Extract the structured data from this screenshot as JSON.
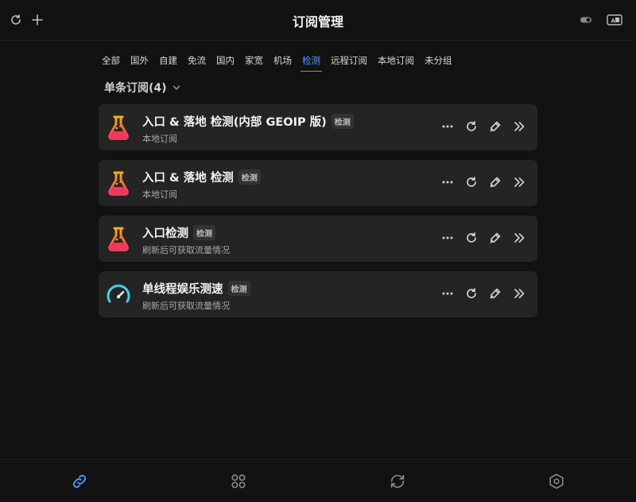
{
  "header": {
    "title": "订阅管理",
    "left_icons": [
      "refresh-icon",
      "plus-icon"
    ],
    "right_icons": [
      "toggle-icon",
      "translate-icon"
    ]
  },
  "tabs": [
    {
      "label": "全部",
      "active": false
    },
    {
      "label": "国外",
      "active": false
    },
    {
      "label": "自建",
      "active": false
    },
    {
      "label": "免流",
      "active": false
    },
    {
      "label": "国内",
      "active": false
    },
    {
      "label": "家宽",
      "active": false
    },
    {
      "label": "机场",
      "active": false
    },
    {
      "label": "检测",
      "active": true
    },
    {
      "label": "远程订阅",
      "active": false
    },
    {
      "label": "本地订阅",
      "active": false
    },
    {
      "label": "未分组",
      "active": false
    }
  ],
  "group": {
    "title": "单条订阅(4)"
  },
  "subscriptions": [
    {
      "title": "入口 & 落地 检测(内部 GEOIP 版)",
      "badge": "检测",
      "subtitle": "本地订阅",
      "icon": "flask-icon"
    },
    {
      "title": "入口 & 落地 检测",
      "badge": "检测",
      "subtitle": "本地订阅",
      "icon": "flask-icon"
    },
    {
      "title": "入口检测",
      "badge": "检测",
      "subtitle": "刷新后可获取流量情况",
      "icon": "flask-icon"
    },
    {
      "title": "单线程娱乐测速",
      "badge": "检测",
      "subtitle": "刷新后可获取流量情况",
      "icon": "speedometer-icon"
    }
  ],
  "bottom_nav": [
    {
      "name": "link-icon",
      "active": true
    },
    {
      "name": "grid-icon",
      "active": false
    },
    {
      "name": "sync-icon",
      "active": false
    },
    {
      "name": "settings-hexagon-icon",
      "active": false
    }
  ],
  "colors": {
    "background": "#121212",
    "card": "#242424",
    "accent": "#4d9bff",
    "flask_top": "#f4b400",
    "flask_bottom": "#f5365c",
    "gauge": "#3fd3e8"
  }
}
